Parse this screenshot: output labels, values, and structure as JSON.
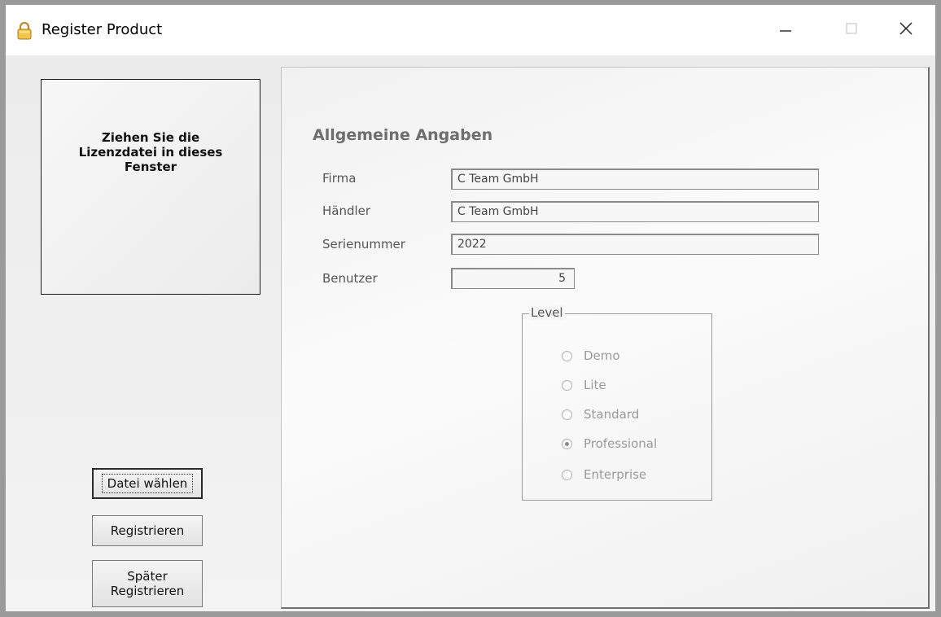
{
  "window": {
    "title": "Register Product"
  },
  "dropzone": {
    "text": "Ziehen Sie die Lizenzdatei in dieses Fenster"
  },
  "buttons": {
    "select_file": "Datei wählen",
    "register": "Registrieren",
    "register_later_line1": "Später",
    "register_later_line2": "Registrieren"
  },
  "form": {
    "section_title": "Allgemeine Angaben",
    "company_label": "Firma",
    "company_value": "C Team GmbH",
    "dealer_label": "Händler",
    "dealer_value": "C Team GmbH",
    "serial_label": "Serienummer",
    "serial_value": "2022",
    "users_label": "Benutzer",
    "users_value": "5"
  },
  "level": {
    "legend": "Level",
    "options": [
      "Demo",
      "Lite",
      "Standard",
      "Professional",
      "Enterprise"
    ],
    "selected": "Professional"
  },
  "icons": {
    "app": "padlock-icon",
    "minimize": "minimize-icon",
    "maximize": "maximize-icon",
    "close": "close-icon"
  }
}
